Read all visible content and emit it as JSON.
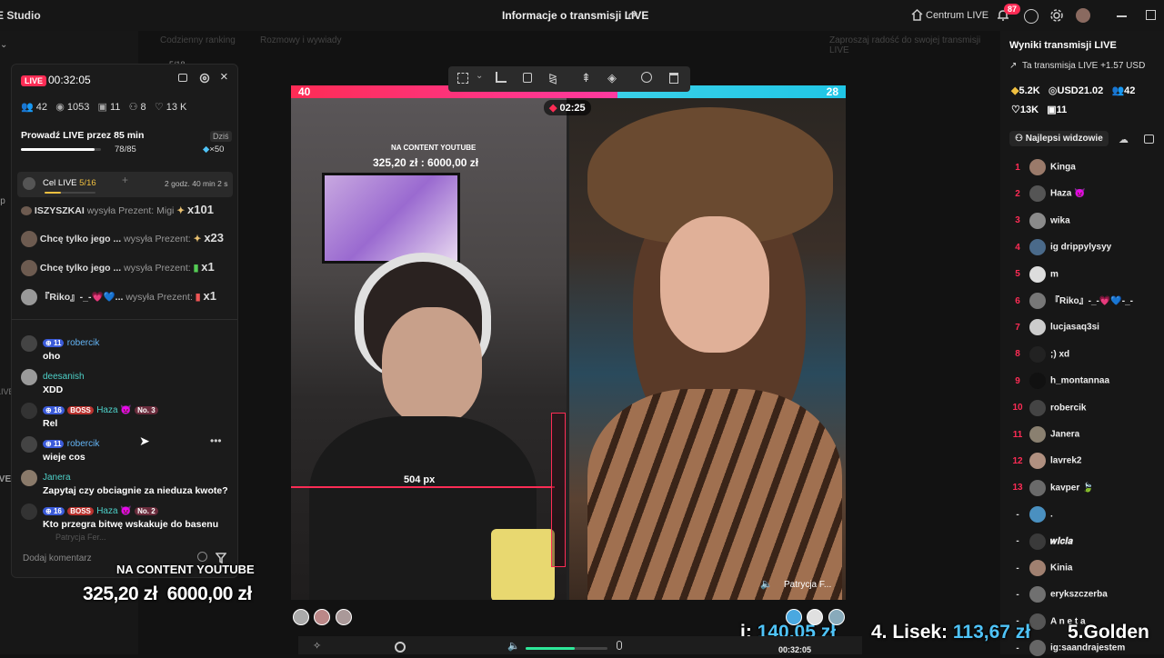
{
  "topbar": {
    "app_title": "E Studio",
    "center_title": "Informacje o transmisji LIVE",
    "centrum_label": "Centrum LIVE",
    "notifications_count": "87"
  },
  "subbar": {
    "daily_ranking": "Codzienny ranking",
    "chats_and_calls": "Rozmowy i wywiady",
    "invite_hint": "Zaproszaj radość do swojej transmisji LIVE"
  },
  "left_strip": {
    "item_top": "5/18",
    "cut_labels": [
      "ip",
      "LIVE",
      "IVE"
    ],
    "placeholder_text": "Patrycja Fer..."
  },
  "panel": {
    "live_label": "LIVE",
    "timer": "00:32:05",
    "stats": {
      "people": "42",
      "views": "1053",
      "gifts": "11",
      "shares": "8",
      "likes": "13 K"
    },
    "mission": {
      "title": "Prowadź LIVE przez 85 min",
      "period": "Dziś",
      "progress_text": "78/85",
      "progress": 0.918,
      "reward": "×50"
    },
    "goal": {
      "label": "Cel LIVE",
      "count": "5/16",
      "time_left": "2 godz. 40 min 2 s",
      "progress": 0.3125
    },
    "gifts": [
      {
        "user": "ISZYSZKAI",
        "action": "wysyła Prezent: Migi",
        "count": "x101"
      },
      {
        "user": "Chcę tylko jego ...",
        "action": "wysyła Prezent:",
        "count": "x23"
      },
      {
        "user": "Chcę tylko jego ...",
        "action": "wysyła Prezent:",
        "count": "x1"
      },
      {
        "user": "『Riko』-_-💗💙...",
        "action": "wysyła Prezent:",
        "count": "x1"
      }
    ],
    "comments": [
      {
        "name": "robercik",
        "level": "11",
        "text": "oho"
      },
      {
        "name": "deesanish",
        "level": "",
        "text": "XDD"
      },
      {
        "name": "Haza 👿",
        "level": "16",
        "boss": "BOSS",
        "rank": "No. 3",
        "text": "Rel"
      },
      {
        "name": "robercik",
        "level": "11",
        "text": "wieje cos"
      },
      {
        "name": "Janera",
        "level": "",
        "text": "Zapytaj czy obciagnie za nieduza kwote?"
      },
      {
        "name": "Haza 👿",
        "level": "16",
        "boss": "BOSS",
        "rank": "No. 2",
        "text": "Kto przegra bitwę wskakuje do basenu"
      }
    ],
    "comment_placeholder": "Dodaj komentarz"
  },
  "overlay": {
    "content_title": "NA CONTENT YOUTUBE",
    "amount": "325,20 zł",
    "goal": "6000,00 zł",
    "stream_title": "NA CONTENT YOUTUBE",
    "stream_amount": "325,20 zł : 6000,00 zł",
    "measure": "504 px",
    "ticker_1_prefix": "i:",
    "ticker_1_value": "140,05 zł",
    "ticker_2_prefix": "4. Lisek:",
    "ticker_2_value": "113,67 zł",
    "ticker_3": "5.Golden"
  },
  "battle": {
    "left_score": "40",
    "right_score": "28",
    "left_share": 0.588,
    "timer": "02:25",
    "right_name": "Patrycja F..."
  },
  "right_panel": {
    "title": "Wyniki transmisji LIVE",
    "earnings": "Ta transmisja LIVE +1.57 USD",
    "coins": "5.2K",
    "usd": "USD21.02",
    "viewers": "42",
    "likes": "13K",
    "gifts": "11",
    "top_viewers_label": "Najlepsi widzowie",
    "viewers_list": [
      {
        "rank": "1",
        "name": "Kinga"
      },
      {
        "rank": "2",
        "name": "Haza 👿"
      },
      {
        "rank": "3",
        "name": "wika"
      },
      {
        "rank": "4",
        "name": "ig drippylysyy"
      },
      {
        "rank": "5",
        "name": "m"
      },
      {
        "rank": "6",
        "name": "『Riko』-_-💗💙-_-"
      },
      {
        "rank": "7",
        "name": "lucjasaq3si"
      },
      {
        "rank": "8",
        "name": ";) xd"
      },
      {
        "rank": "9",
        "name": "h_montannaa"
      },
      {
        "rank": "10",
        "name": "robercik"
      },
      {
        "rank": "11",
        "name": "Janera"
      },
      {
        "rank": "12",
        "name": "lavrek2"
      },
      {
        "rank": "13",
        "name": "kavper 🍃"
      },
      {
        "rank": "-",
        "name": "."
      },
      {
        "rank": "-",
        "name": "𝒘𝒊𝒄𝒊𝒂"
      },
      {
        "rank": "-",
        "name": "Kinia"
      },
      {
        "rank": "-",
        "name": "erykszczerba"
      },
      {
        "rank": "-",
        "name": "A n e t a"
      },
      {
        "rank": "-",
        "name": "ig:saandrajestem"
      }
    ]
  },
  "bottom": {
    "time": "00:32:05"
  }
}
